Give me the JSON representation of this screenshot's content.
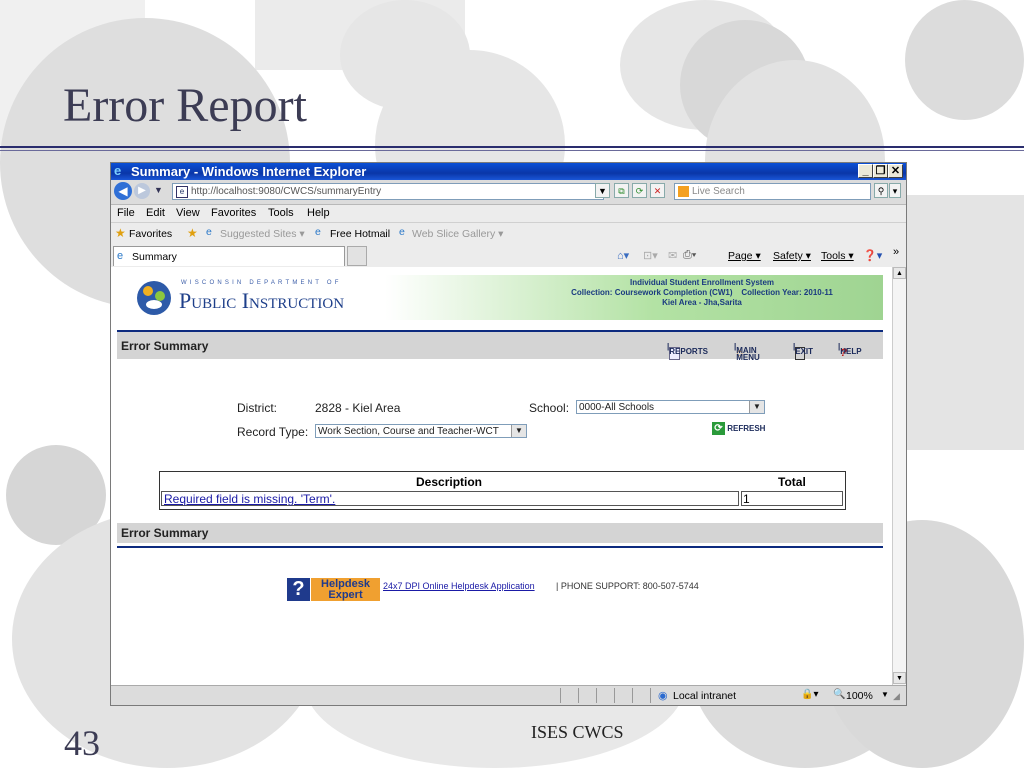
{
  "slide": {
    "title": "Error Report",
    "number": "43",
    "footer": "ISES CWCS"
  },
  "browser": {
    "title": "Summary - Windows Internet Explorer",
    "address": "http://localhost:9080/CWCS/summaryEntry",
    "search_placeholder": "Live Search",
    "menu": [
      "File",
      "Edit",
      "View",
      "Favorites",
      "Tools",
      "Help"
    ],
    "favorites": {
      "label": "Favorites",
      "items": [
        "Suggested Sites ▾",
        "Free Hotmail",
        "Web Slice Gallery ▾"
      ]
    },
    "tab": "Summary",
    "commands": [
      "Page ▾",
      "Safety ▾",
      "Tools ▾"
    ],
    "status": {
      "zone": "Local intranet",
      "zoom": "100%"
    }
  },
  "page": {
    "logo": {
      "top": "WISCONSIN DEPARTMENT OF",
      "main": "Public Instruction"
    },
    "system": {
      "name": "Individual Student Enrollment System",
      "collection": "Collection: Coursework Completion (CW1)",
      "year": "Collection Year: 2010-11",
      "district": "Kiel Area - Jha,Sarita"
    },
    "section_title": "Error Summary",
    "toolbar": {
      "reports": "REPORTS",
      "main_menu": "MAIN MENU",
      "exit": "EXIT",
      "help": "HELP"
    },
    "form": {
      "district_label": "District:",
      "district_value": "2828 - Kiel Area",
      "school_label": "School:",
      "school_value": "0000-All Schools",
      "record_type_label": "Record Type:",
      "record_type_value": "Work Section, Course and Teacher-WCT",
      "refresh": "REFRESH"
    },
    "table": {
      "headers": [
        "Description",
        "Total"
      ],
      "rows": [
        {
          "description": "Required field is missing. 'Term'.",
          "total": "1"
        }
      ]
    },
    "footer_section_title": "Error Summary",
    "helpdesk": {
      "badge_line1": "Helpdesk",
      "badge_line2": "Expert",
      "link": "24x7 DPI Online Helpdesk Application",
      "phone": "| PHONE SUPPORT: 800-507-5744"
    }
  }
}
